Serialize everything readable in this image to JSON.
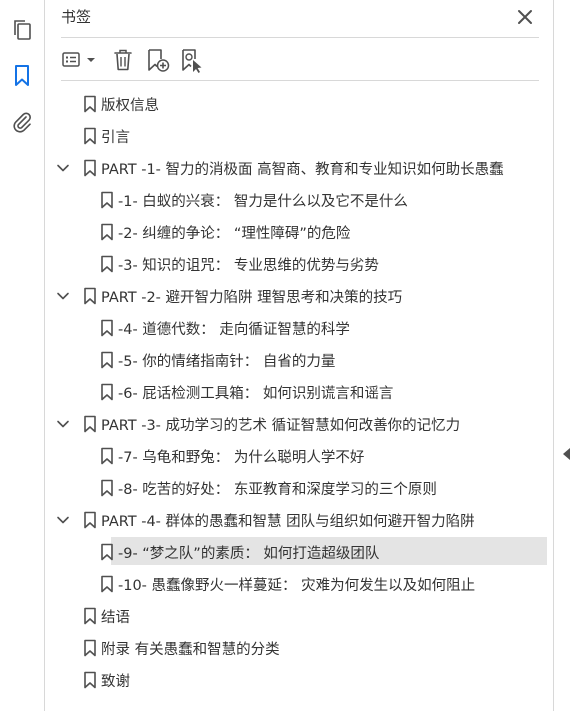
{
  "panel": {
    "title": "书签"
  },
  "left_rail": {
    "items": [
      {
        "icon": "pages-icon"
      },
      {
        "icon": "bookmark-icon",
        "active": true
      },
      {
        "icon": "attachment-icon"
      }
    ]
  },
  "toolbar": {
    "buttons": [
      "options-menu",
      "delete-bookmark",
      "add-bookmark",
      "bookmark-from-selection"
    ]
  },
  "colors": {
    "accent": "#1473e6",
    "icon": "#505050",
    "selected_bg": "#e4e4e4"
  },
  "bookmarks": [
    {
      "level": 0,
      "label": "版权信息"
    },
    {
      "level": 0,
      "label": "引言"
    },
    {
      "level": 0,
      "expandable": true,
      "expanded": true,
      "label": "PART -1- 智力的消极面 高智商、教育和专业知识如何助长愚蠢"
    },
    {
      "level": 1,
      "label": "-1- 白蚁的兴衰： 智力是什么以及它不是什么"
    },
    {
      "level": 1,
      "label": "-2- 纠缠的争论： “理性障碍”的危险"
    },
    {
      "level": 1,
      "label": "-3- 知识的诅咒： 专业思维的优势与劣势"
    },
    {
      "level": 0,
      "expandable": true,
      "expanded": true,
      "label": "PART -2- 避开智力陷阱 理智思考和决策的技巧"
    },
    {
      "level": 1,
      "label": "-4- 道德代数： 走向循证智慧的科学"
    },
    {
      "level": 1,
      "label": "-5- 你的情绪指南针： 自省的力量"
    },
    {
      "level": 1,
      "label": "-6- 屁话检测工具箱： 如何识别谎言和谣言"
    },
    {
      "level": 0,
      "expandable": true,
      "expanded": true,
      "label": "PART -3- 成功学习的艺术 循证智慧如何改善你的记忆力"
    },
    {
      "level": 1,
      "label": "-7- 乌龟和野兔： 为什么聪明人学不好"
    },
    {
      "level": 1,
      "label": "-8- 吃苦的好处： 东亚教育和深度学习的三个原则"
    },
    {
      "level": 0,
      "expandable": true,
      "expanded": true,
      "label": "PART -4- 群体的愚蠢和智慧 团队与组织如何避开智力陷阱"
    },
    {
      "level": 1,
      "selected": true,
      "label": "-9- “梦之队”的素质： 如何打造超级团队"
    },
    {
      "level": 1,
      "label": "-10- 愚蠢像野火一样蔓延： 灾难为何发生以及如何阻止"
    },
    {
      "level": 0,
      "label": "结语"
    },
    {
      "level": 0,
      "label": "附录 有关愚蠢和智慧的分类"
    },
    {
      "level": 0,
      "label": "致谢"
    }
  ]
}
